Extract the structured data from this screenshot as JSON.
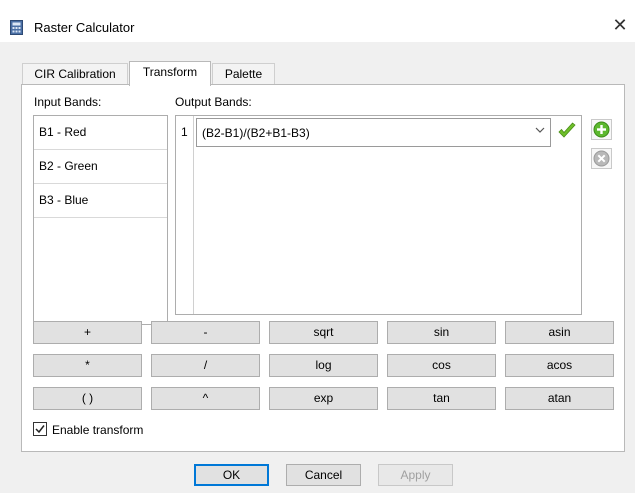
{
  "window": {
    "title": "Raster Calculator",
    "close_symbol": "✕",
    "app_icon": "raster-calculator-icon"
  },
  "tabs": [
    {
      "label": "CIR Calibration",
      "active": false
    },
    {
      "label": "Transform",
      "active": true
    },
    {
      "label": "Palette",
      "active": false
    }
  ],
  "input_bands": {
    "label": "Input Bands:",
    "items": [
      "B1 - Red",
      "B2 - Green",
      "B3 - Blue"
    ]
  },
  "output_bands": {
    "label": "Output Bands:",
    "rows": [
      {
        "number": "1",
        "expression": "(B2-B1)/(B2+B1-B3)"
      }
    ]
  },
  "side_buttons": {
    "add_icon": "add-green-icon",
    "remove_icon": "remove-gray-icon"
  },
  "operators": [
    [
      "+",
      "-",
      "sqrt",
      "sin",
      "asin"
    ],
    [
      "*",
      "/",
      "log",
      "cos",
      "acos"
    ],
    [
      "( )",
      "^",
      "exp",
      "tan",
      "atan"
    ]
  ],
  "enable_transform": {
    "label": "Enable transform",
    "checked": true
  },
  "footer": {
    "ok": "OK",
    "cancel": "Cancel",
    "apply": "Apply"
  },
  "colors": {
    "accent_blue": "#0078d7",
    "check_green": "#6fbf2a"
  }
}
